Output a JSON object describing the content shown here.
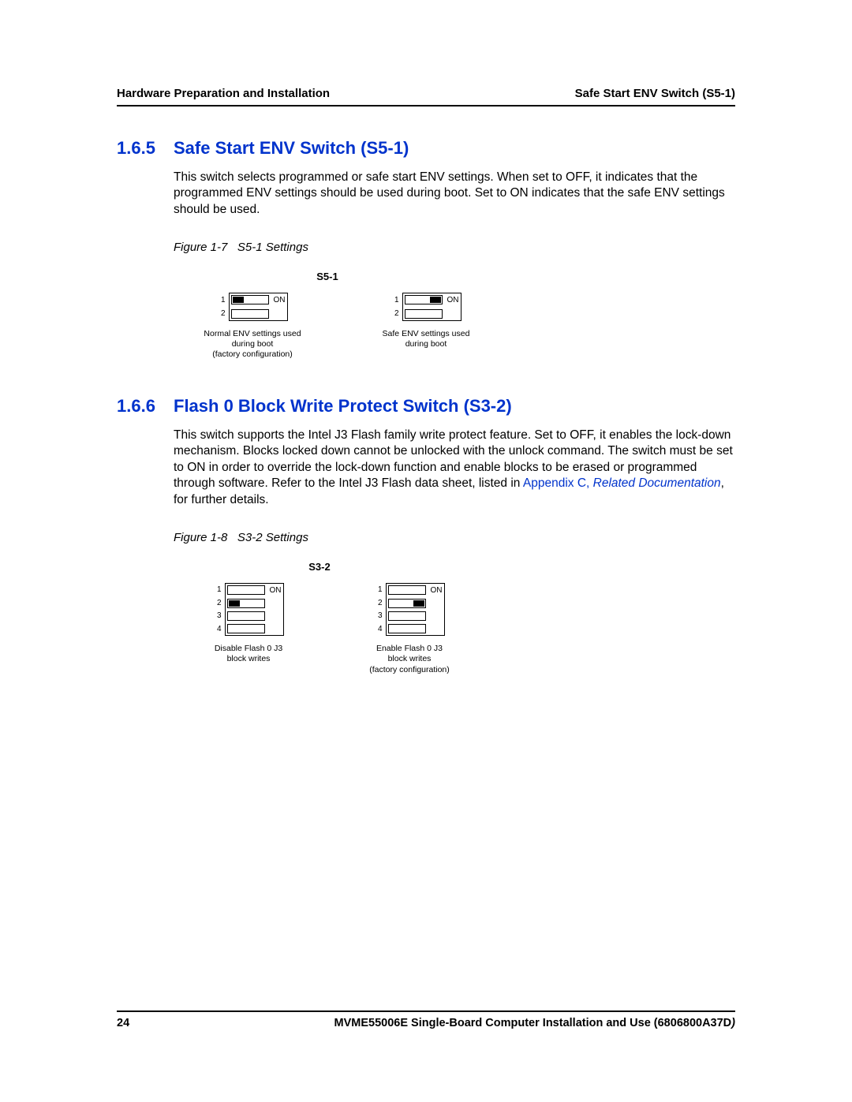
{
  "header": {
    "left": "Hardware Preparation and Installation",
    "right": "Safe Start ENV Switch (S5-1)"
  },
  "section1": {
    "num": "1.6.5",
    "title": "Safe Start ENV Switch (S5-1)",
    "body": "This switch selects programmed or safe start ENV settings. When set to OFF, it indicates that the programmed ENV settings should be used during boot. Set to ON indicates that the safe ENV settings should be used.",
    "figure_caption_prefix": "Figure 1-7",
    "figure_caption_title": "S5-1 Settings",
    "switch_header": "S5-1",
    "on_label": "ON",
    "nums": [
      "1",
      "2"
    ],
    "left_caption_l1": "Normal ENV settings used",
    "left_caption_l2": "during boot",
    "left_caption_l3": "(factory configuration)",
    "right_caption_l1": "Safe ENV settings used",
    "right_caption_l2": "during boot"
  },
  "section2": {
    "num": "1.6.6",
    "title": "Flash 0 Block Write Protect Switch (S3-2)",
    "body_pre": "This switch supports the Intel J3 Flash family write protect feature. Set to OFF, it enables the lock-down mechanism. Blocks locked down cannot be unlocked with the unlock command. The switch must be set to ON in order to override the lock-down function and enable blocks to be erased or programmed through software. Refer to the Intel J3 Flash data sheet, listed in ",
    "link_appendix": "Appendix C, ",
    "link_doc": "Related Documentation",
    "body_post": ", for further details.",
    "figure_caption_prefix": "Figure 1-8",
    "figure_caption_title": "S3-2 Settings",
    "switch_header": "S3-2",
    "on_label": "ON",
    "nums": [
      "1",
      "2",
      "3",
      "4"
    ],
    "left_caption_l1": "Disable Flash 0 J3",
    "left_caption_l2": "block writes",
    "right_caption_l1": "Enable Flash 0 J3",
    "right_caption_l2": "block writes",
    "right_caption_l3": "(factory configuration)"
  },
  "footer": {
    "page": "24",
    "title_main": "MVME55006E Single-Board Computer Installation and Use (6806800A37D",
    "title_close": ")"
  }
}
